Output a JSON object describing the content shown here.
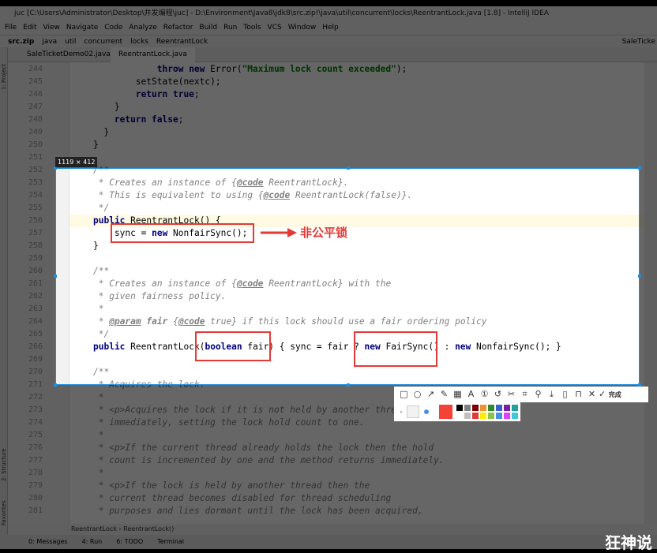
{
  "window": {
    "title": "juc [C:\\Users\\Administrator\\Desktop\\并发编程\\juc] - D:\\Environment\\Java8\\jdk8\\src.zip!\\java\\util\\concurrent\\locks\\ReentrantLock.java [1.8] - IntelliJ IDEA"
  },
  "menu": [
    "File",
    "Edit",
    "View",
    "Navigate",
    "Code",
    "Analyze",
    "Refactor",
    "Build",
    "Run",
    "Tools",
    "VCS",
    "Window",
    "Help"
  ],
  "breadcrumb": [
    "src.zip",
    "java",
    "util",
    "concurrent",
    "locks",
    "ReentrantLock"
  ],
  "run_config": "SaleTicke",
  "tabs": [
    "SaleTicketDemo02.java",
    "ReentrantLock.java"
  ],
  "side_tabs": {
    "project": "1: Project",
    "structure": "2: Structure",
    "favorites": "Favorites"
  },
  "code_lines": [
    {
      "n": "244",
      "html": "            <span class='kw'>throw new</span> Error(<span class='str'>\"Maximum lock count exceeded\"</span>);"
    },
    {
      "n": "245",
      "html": "        setState(nextc);"
    },
    {
      "n": "246",
      "html": "        <span class='kw'>return true</span>;"
    },
    {
      "n": "247",
      "html": "    }"
    },
    {
      "n": "248",
      "html": "    <span class='kw'>return false</span>;"
    },
    {
      "n": "249",
      "html": "  }"
    },
    {
      "n": "250",
      "html": "}"
    },
    {
      "n": "251",
      "html": ""
    },
    {
      "n": "252",
      "html": "<span class='cm'>/**</span>"
    },
    {
      "n": "253",
      "html": "<span class='cm'> * Creates an instance of {<span class='tag'>@code</span> ReentrantLock}.</span>"
    },
    {
      "n": "254",
      "html": "<span class='cm'> * This is equivalent to using {<span class='tag'>@code</span> ReentrantLock(false)}.</span>"
    },
    {
      "n": "255",
      "html": "<span class='cm'> */</span>"
    },
    {
      "n": "256",
      "html": "<span class='kw'>public</span> ReentrantLock() {"
    },
    {
      "n": "257",
      "html": "    sync = <span class='kw'>new</span> NonfairSync();"
    },
    {
      "n": "258",
      "html": "}"
    },
    {
      "n": "259",
      "html": ""
    },
    {
      "n": "260",
      "html": "<span class='cm'>/**</span>"
    },
    {
      "n": "261",
      "html": "<span class='cm'> * Creates an instance of {<span class='tag'>@code</span> ReentrantLock} with the</span>"
    },
    {
      "n": "262",
      "html": "<span class='cm'> * given fairness policy.</span>"
    },
    {
      "n": "263",
      "html": "<span class='cm'> *</span>"
    },
    {
      "n": "264",
      "html": "<span class='cm'> * <span class='tag'>@param</span> <b>fair</b> {<span class='tag'>@code</span> true} if this lock should use a fair ordering policy</span>"
    },
    {
      "n": "265",
      "html": "<span class='cm'> */</span>"
    },
    {
      "n": "266",
      "html": "<span class='kw'>public</span> ReentrantLock(<span class='kw'>boolean</span> fair) { sync = fair ? <span class='kw'>new</span> FairSync() : <span class='kw'>new</span> NonfairSync(); }"
    },
    {
      "n": "269",
      "html": ""
    },
    {
      "n": "270",
      "html": "<span class='cm'>/**</span>"
    },
    {
      "n": "271",
      "html": "<span class='cm'> * Acquires the lock.</span>"
    },
    {
      "n": "272",
      "html": "<span class='cm'> *</span>"
    },
    {
      "n": "273",
      "html": "<span class='cm'> * &lt;p&gt;Acquires the lock if it is not held by another thread and returns</span>"
    },
    {
      "n": "274",
      "html": "<span class='cm'> * immediately, setting the lock hold count to one.</span>"
    },
    {
      "n": "275",
      "html": "<span class='cm'> *</span>"
    },
    {
      "n": "276",
      "html": "<span class='cm'> * &lt;p&gt;If the current thread already holds the lock then the hold</span>"
    },
    {
      "n": "277",
      "html": "<span class='cm'> * count is incremented by one and the method returns immediately.</span>"
    },
    {
      "n": "278",
      "html": "<span class='cm'> *</span>"
    },
    {
      "n": "279",
      "html": "<span class='cm'> * &lt;p&gt;If the lock is held by another thread then the</span>"
    },
    {
      "n": "280",
      "html": "<span class='cm'> * current thread becomes disabled for thread scheduling</span>"
    },
    {
      "n": "281",
      "html": "<span class='cm'> * purposes and lies dormant until the lock has been acquired,</span>"
    }
  ],
  "status_breadcrumb": "ReentrantLock  ›  ReentrantLock()",
  "bottom_tabs": [
    "0: Messages",
    "4: Run",
    "6: TODO",
    "Terminal"
  ],
  "screenshot": {
    "size_label": "1119 × 412",
    "annotation": "非公平锁",
    "annotation_color": "#e53935",
    "done_label": "完成",
    "tools": [
      "rectangle-icon",
      "ellipse-icon",
      "arrow-icon",
      "pen-icon",
      "mosaic-icon",
      "text-icon",
      "number-icon",
      "undo-icon",
      "crop-icon",
      "pin-region-icon",
      "pin-icon",
      "download-icon",
      "save-icon",
      "bookmark-icon",
      "close-icon"
    ],
    "colors": [
      "#000000",
      "#808080",
      "#800000",
      "#f0902f",
      "#2e8b2e",
      "#3a5fcd",
      "#7b1fa2",
      "#20a0a0",
      "#ffffff",
      "#c0c0c0",
      "#e53935",
      "#ffee00",
      "#8bc34a",
      "#4a90e2",
      "#e040fb",
      "#40c8d8"
    ]
  },
  "watermark": "狂神说"
}
